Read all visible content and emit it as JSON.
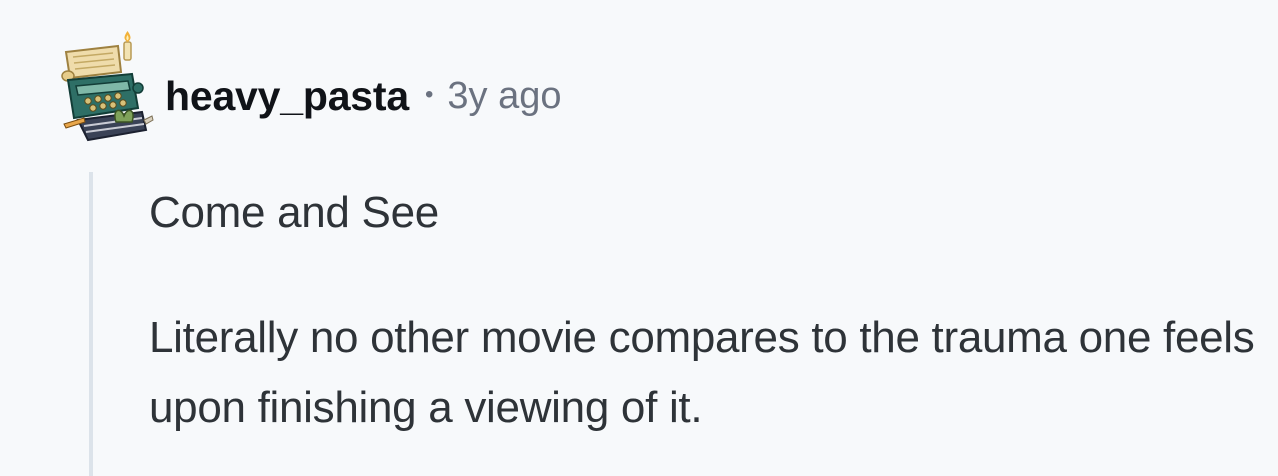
{
  "comment": {
    "author": "heavy_pasta",
    "separator": "•",
    "time_ago": "3y ago",
    "avatar_icon": "typewriter-snoo-avatar-icon",
    "paragraphs": [
      "Come and See",
      "Literally no other movie compares to the trauma one feels upon finishing a viewing of it."
    ]
  },
  "colors": {
    "background": "#f7f9fb",
    "username": "#101318",
    "meta": "#6b7280",
    "body_text": "#2e3338",
    "thread_line": "#dce3ea"
  }
}
